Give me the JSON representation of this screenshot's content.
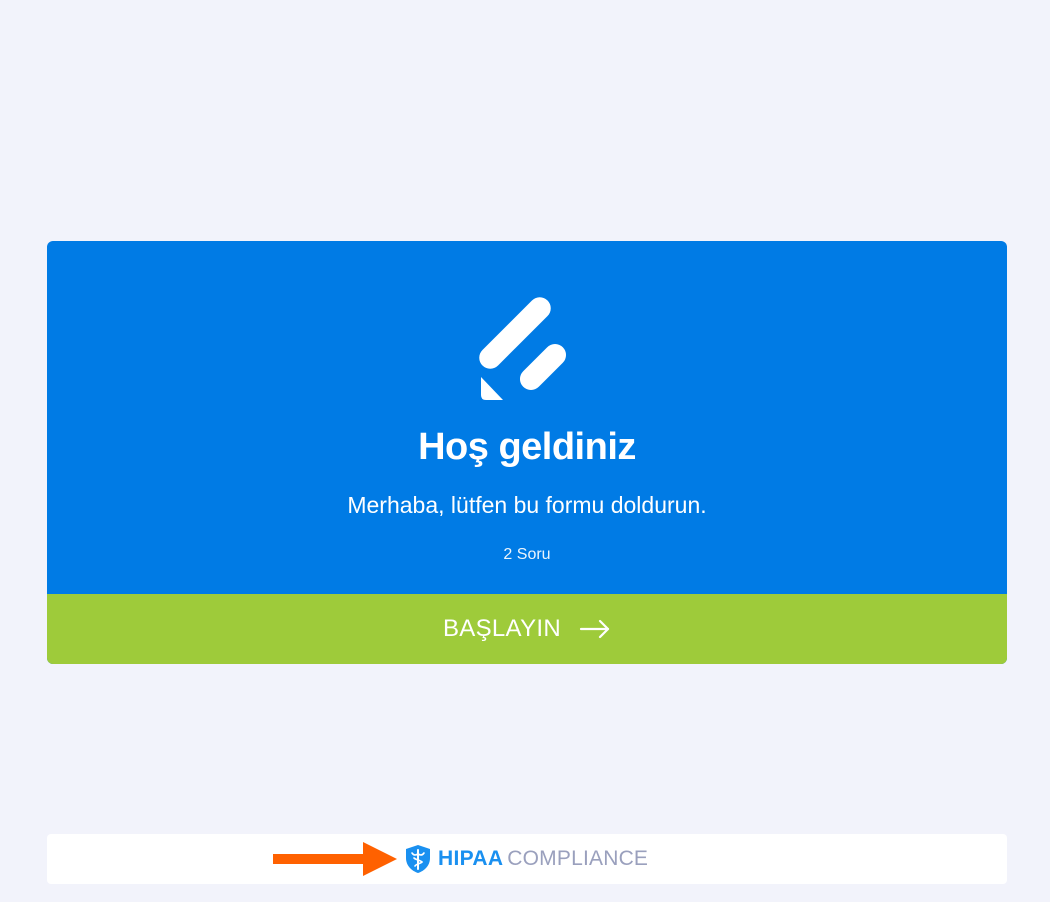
{
  "welcome": {
    "title": "Hoş geldiniz",
    "subtitle": "Merhaba, lütfen bu formu doldurun.",
    "question_count": "2 Soru",
    "start_label": "BAŞLAYIN",
    "logo_icon": "jotform-logo-icon",
    "arrow_icon": "arrow-right-icon"
  },
  "footer": {
    "hipaa_strong": "HIPAA",
    "hipaa_light": "COMPLIANCE",
    "shield_icon": "shield-caduceus-icon",
    "pointer_icon": "orange-arrow-icon"
  },
  "colors": {
    "page_background": "#f2f3fb",
    "card_blue": "#007be5",
    "start_green": "#9ecb3a",
    "hipaa_blue": "#1a90f0",
    "hipaa_gray": "#9aa0bd",
    "pointer_orange": "#ff6100"
  }
}
